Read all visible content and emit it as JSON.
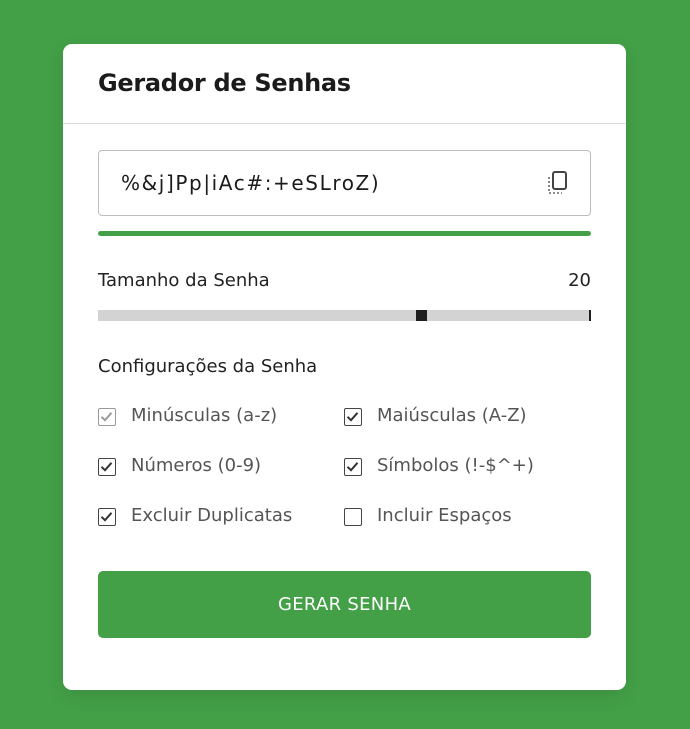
{
  "header": {
    "title": "Gerador de Senhas"
  },
  "password": {
    "value": "%&j]Pp|iAc#:+eSLroZ)",
    "copy_icon": "copy-icon"
  },
  "strength": {
    "level": 1.0,
    "color": "#43a047"
  },
  "length": {
    "label": "Tamanho da Senha",
    "value": "20",
    "min": 1,
    "max": 30,
    "current": 20
  },
  "settings": {
    "title": "Configurações da Senha",
    "options": [
      {
        "label": "Minúsculas (a-z)",
        "checked": true,
        "disabled": true
      },
      {
        "label": "Maiúsculas (A-Z)",
        "checked": true,
        "disabled": false
      },
      {
        "label": "Números (0-9)",
        "checked": true,
        "disabled": false
      },
      {
        "label": "Símbolos (!-$^+)",
        "checked": true,
        "disabled": false
      },
      {
        "label": "Excluir Duplicatas",
        "checked": true,
        "disabled": false
      },
      {
        "label": "Incluir Espaços",
        "checked": false,
        "disabled": false
      }
    ]
  },
  "generate_button": {
    "label": "GERAR SENHA"
  },
  "colors": {
    "accent": "#43a047",
    "background": "#43a047",
    "card": "#ffffff"
  }
}
